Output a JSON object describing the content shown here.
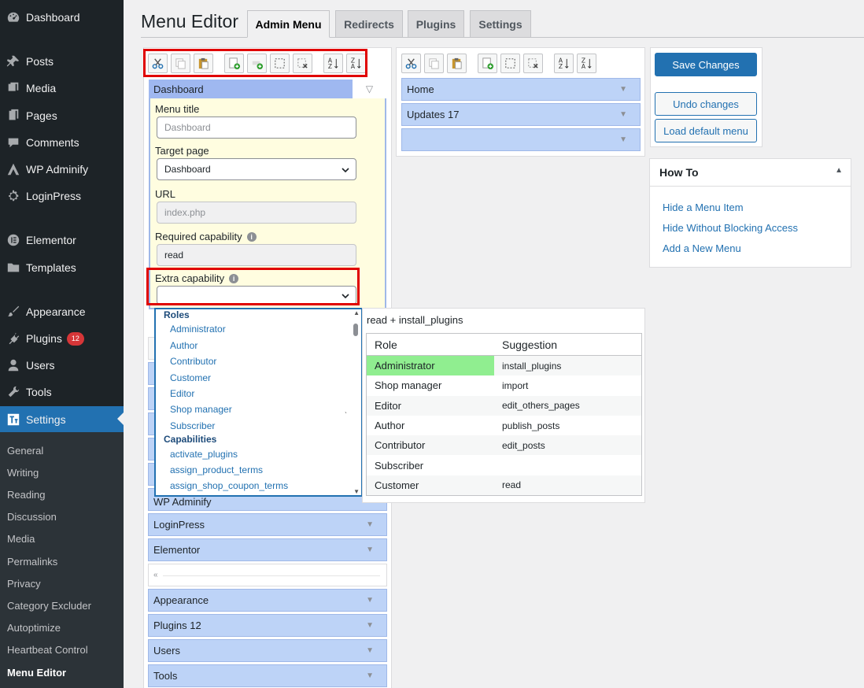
{
  "sidebar": {
    "items": [
      {
        "label": "Dashboard",
        "icon": "dashboard-icon"
      },
      {
        "label": "Posts",
        "icon": "pin-icon"
      },
      {
        "label": "Media",
        "icon": "media-icon"
      },
      {
        "label": "Pages",
        "icon": "pages-icon"
      },
      {
        "label": "Comments",
        "icon": "comments-icon"
      },
      {
        "label": "WP Adminify",
        "icon": "adminify-icon"
      },
      {
        "label": "LoginPress",
        "icon": "gear-icon"
      },
      {
        "label": "Elementor",
        "icon": "elementor-icon"
      },
      {
        "label": "Templates",
        "icon": "folder-icon"
      },
      {
        "label": "Appearance",
        "icon": "brush-icon"
      },
      {
        "label": "Plugins",
        "icon": "plugin-icon",
        "badge": "12"
      },
      {
        "label": "Users",
        "icon": "user-icon"
      },
      {
        "label": "Tools",
        "icon": "wrench-icon"
      },
      {
        "label": "Settings",
        "icon": "settings-icon"
      }
    ],
    "submenu": [
      "General",
      "Writing",
      "Reading",
      "Discussion",
      "Media",
      "Permalinks",
      "Privacy",
      "Category Excluder",
      "Autoptimize",
      "Heartbeat Control",
      "Menu Editor"
    ]
  },
  "header": {
    "title": "Menu Editor",
    "tabs": [
      "Admin Menu",
      "Redirects",
      "Plugins",
      "Settings"
    ]
  },
  "left_menu": {
    "dashboard_label": "Dashboard",
    "editor": {
      "menu_title_label": "Menu title",
      "menu_title_placeholder": "Dashboard",
      "target_page_label": "Target page",
      "target_page_value": "Dashboard",
      "url_label": "URL",
      "url_value": "index.php",
      "required_cap_label": "Required capability",
      "required_cap_value": "read",
      "extra_cap_label": "Extra capability",
      "extra_cap_value": ""
    },
    "items_below": [
      "WP Adminify",
      "LoginPress",
      "Elementor",
      "",
      "Appearance",
      "Plugins 12",
      "Users",
      "Tools"
    ]
  },
  "capability_list": {
    "roles_label": "Roles",
    "roles": [
      "Administrator",
      "Author",
      "Contributor",
      "Customer",
      "Editor",
      "Shop manager",
      "Subscriber"
    ],
    "capabilities_label": "Capabilities",
    "capabilities": [
      "activate_plugins",
      "assign_product_terms",
      "assign_shop_coupon_terms"
    ]
  },
  "suggestion": {
    "header": "read + install_plugins",
    "col_role": "Role",
    "col_suggestion": "Suggestion",
    "rows": [
      {
        "role": "Administrator",
        "cap": "install_plugins"
      },
      {
        "role": "Shop manager",
        "cap": "import"
      },
      {
        "role": "Editor",
        "cap": "edit_others_pages"
      },
      {
        "role": "Author",
        "cap": "publish_posts"
      },
      {
        "role": "Contributor",
        "cap": "edit_posts"
      },
      {
        "role": "Subscriber",
        "cap": ""
      },
      {
        "role": "Customer",
        "cap": "read"
      }
    ],
    "highlight_color": "#90ee90"
  },
  "submenu_panel": {
    "items": [
      "Home",
      "Updates 17",
      ""
    ]
  },
  "actions": {
    "save": "Save Changes",
    "undo": "Undo changes",
    "load_default": "Load default menu"
  },
  "howto": {
    "title": "How To",
    "links": [
      "Hide a Menu Item",
      "Hide Without Blocking Access",
      "Add a New Menu"
    ]
  },
  "colors": {
    "accent": "#2271b1",
    "sidebar_bg": "#1d2327",
    "menu_item_bg": "#bdd3f7",
    "editor_bg": "#fffde0",
    "highlight_box": "#e00000"
  }
}
